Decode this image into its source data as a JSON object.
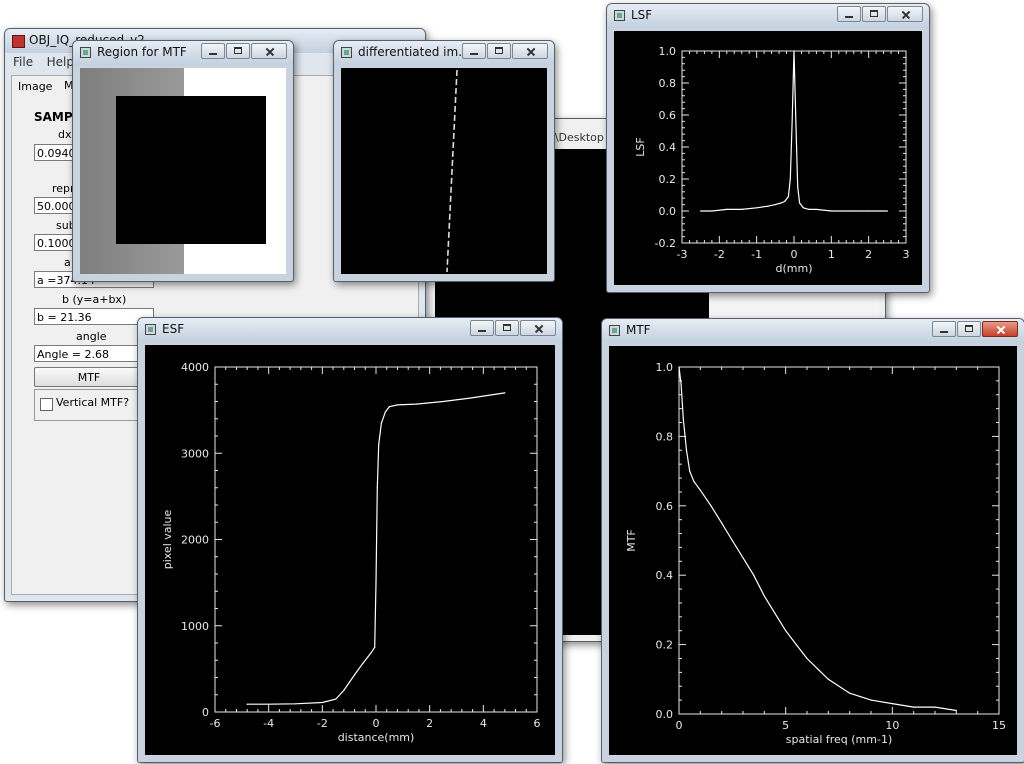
{
  "main_window": {
    "title": "OBJ_IQ_reduced_v2",
    "menus": [
      "File",
      "Help"
    ],
    "tabs": [
      "Image",
      "M"
    ],
    "section_title": "SAMPL",
    "fields": [
      {
        "label": "dx",
        "value": "0.09409"
      },
      {
        "label": "repro",
        "value": "50.0000"
      },
      {
        "label": "sub",
        "value": "0.10000"
      },
      {
        "label": "a",
        "value": "a =374.14"
      },
      {
        "label": "b (y=a+bx)",
        "value": "b = 21.36"
      },
      {
        "label": "angle",
        "value": "Angle =  2.68"
      }
    ],
    "mtf_button": "MTF",
    "checkbox_label": "Vertical MTF?"
  },
  "bg_window": {
    "path_fragment": "el\\Desktop"
  },
  "windows": {
    "region": {
      "title": "Region for MTF"
    },
    "diff": {
      "title": "differentiated im..."
    },
    "lsf": {
      "title": "LSF"
    },
    "esf": {
      "title": "ESF"
    },
    "mtf": {
      "title": "MTF"
    }
  },
  "chart_data": [
    {
      "id": "lsf",
      "type": "line",
      "xlabel": "d(mm)",
      "ylabel": "LSF",
      "xlim": [
        -3,
        3
      ],
      "ylim": [
        -0.2,
        1.0
      ],
      "xticks": [
        -3,
        -2,
        -1,
        0,
        1,
        2,
        3
      ],
      "xtick_labels": [
        "-3",
        "-2",
        "-1",
        "0",
        "1",
        "2",
        "3"
      ],
      "yticks": [
        -0.2,
        0,
        0.2,
        0.4,
        0.6,
        0.8,
        1.0
      ],
      "ytick_labels": [
        "-0.2",
        "0.0",
        "0.2",
        "0.4",
        "0.6",
        "0.8",
        "1.0"
      ],
      "series": [
        {
          "x": [
            -2.5,
            -2.2,
            -1.8,
            -1.4,
            -1.0,
            -0.7,
            -0.5,
            -0.35,
            -0.25,
            -0.15,
            -0.1,
            -0.05,
            0.0,
            0.05,
            0.1,
            0.15,
            0.25,
            0.4,
            0.6,
            1.0,
            1.5,
            2.0,
            2.5
          ],
          "y": [
            0.0,
            0.0,
            0.01,
            0.01,
            0.02,
            0.03,
            0.04,
            0.05,
            0.06,
            0.09,
            0.2,
            0.55,
            1.0,
            0.55,
            0.15,
            0.05,
            0.02,
            0.01,
            0.01,
            0.0,
            0.0,
            0.0,
            0.0
          ]
        }
      ]
    },
    {
      "id": "esf",
      "type": "line",
      "xlabel": "distance(mm)",
      "ylabel": "pixel value",
      "xlim": [
        -6,
        6
      ],
      "ylim": [
        0,
        4000
      ],
      "xticks": [
        -6,
        -4,
        -2,
        0,
        2,
        4,
        6
      ],
      "xtick_labels": [
        "-6",
        "-4",
        "-2",
        "0",
        "2",
        "4",
        "6"
      ],
      "yticks": [
        0,
        1000,
        2000,
        3000,
        4000
      ],
      "ytick_labels": [
        "0",
        "1000",
        "2000",
        "3000",
        "4000"
      ],
      "series": [
        {
          "x": [
            -4.8,
            -4.0,
            -3.0,
            -2.0,
            -1.5,
            -1.2,
            -0.8,
            -0.5,
            -0.2,
            -0.05,
            0.0,
            0.05,
            0.1,
            0.2,
            0.35,
            0.5,
            0.8,
            1.5,
            2.5,
            3.5,
            4.8
          ],
          "y": [
            90,
            90,
            95,
            110,
            150,
            250,
            430,
            560,
            680,
            750,
            1500,
            2600,
            3100,
            3350,
            3480,
            3540,
            3560,
            3570,
            3600,
            3640,
            3700
          ]
        }
      ]
    },
    {
      "id": "mtf",
      "type": "line",
      "xlabel": "spatial freq (mm-1)",
      "ylabel": "MTF",
      "xlim": [
        0,
        15
      ],
      "ylim": [
        0,
        1.0
      ],
      "xticks": [
        0,
        5,
        10,
        15
      ],
      "xtick_labels": [
        "0",
        "5",
        "10",
        "15"
      ],
      "yticks": [
        0,
        0.2,
        0.4,
        0.6,
        0.8,
        1.0
      ],
      "ytick_labels": [
        "0.0",
        "0.2",
        "0.4",
        "0.6",
        "0.8",
        "1.0"
      ],
      "series": [
        {
          "x": [
            0,
            0.1,
            0.2,
            0.35,
            0.5,
            0.7,
            1.0,
            1.5,
            2.0,
            2.5,
            3.0,
            3.5,
            4.0,
            4.5,
            5.0,
            5.5,
            6.0,
            6.5,
            7.0,
            7.5,
            8.0,
            8.5,
            9.0,
            10.0,
            11.0,
            12.0,
            13.0
          ],
          "y": [
            1.0,
            0.95,
            0.85,
            0.76,
            0.7,
            0.67,
            0.645,
            0.6,
            0.55,
            0.5,
            0.45,
            0.4,
            0.34,
            0.29,
            0.24,
            0.2,
            0.16,
            0.13,
            0.1,
            0.08,
            0.06,
            0.05,
            0.04,
            0.03,
            0.02,
            0.02,
            0.01
          ]
        }
      ]
    }
  ]
}
